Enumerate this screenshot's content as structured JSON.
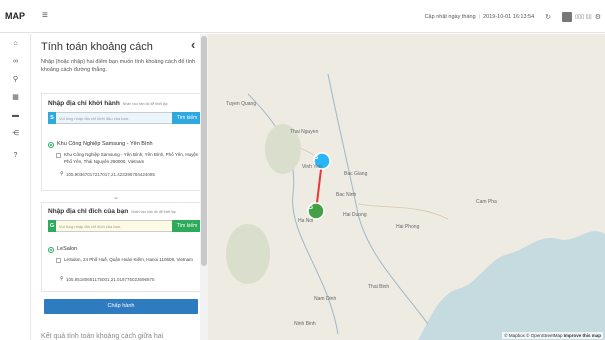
{
  "topbar": {
    "logo": "MAP",
    "menu_icon": "hamburger-icon",
    "update_label": "Cập nhật ngày tháng",
    "update_time": "2019-10-01 16:13:54",
    "user_name": "▯▯▯ ▯▯"
  },
  "icon_rail": [
    {
      "name": "home-icon",
      "glyph": "⌂"
    },
    {
      "name": "binoculars-icon",
      "glyph": "∞"
    },
    {
      "name": "search-icon",
      "glyph": "⚲"
    },
    {
      "name": "calculator-icon",
      "glyph": "▦"
    },
    {
      "name": "truck-icon",
      "glyph": "▬"
    },
    {
      "name": "share-icon",
      "glyph": "⋲"
    },
    {
      "name": "help-icon",
      "glyph": "?"
    }
  ],
  "panel": {
    "title": "Tính toán khoảng cách",
    "description": "Nhập (hoặc nhập) hai điểm bạn muốn tính khoảng cách để tính khoảng cách đường thẳng.",
    "start": {
      "heading": "Nhập địa chỉ khởi hành",
      "hint": "Nhấn vào bản đồ để thiết lập",
      "tag": "S",
      "placeholder": "Vui lòng nhập địa chỉ khởi đầu của bạn.",
      "button": "Tìm kiếm",
      "result_name": "Khu Công Nghiệp Samsung - Yên Bình",
      "result_address": "Khu Công Nghiệp Samsung - Yên Bình, Yên Bình, Phổ Yên, Huyện Phổ Yên, Thái Nguyên 250000, Vietnam",
      "result_coords": "105.90367017217017,21.423395784424095"
    },
    "dest": {
      "heading": "Nhập địa chỉ đích của bạn",
      "hint": "Nhấn vào bản đồ để thiết lập",
      "tag": "G",
      "placeholder": "Vui lòng nhập địa chỉ đích của bạn.",
      "button": "Tìm kiếm",
      "result_name": "LeSalon",
      "result_address": "LeSalon, 24 Phố Huế, Quận Hoàn Kiếm, Hanoi 110509, Vietnam",
      "result_coords": "105.85180681175001,21.018775023696875"
    },
    "execute_button": "Chấp hành",
    "result_heading": "Kết quả tính toán khoảng cách giữa hai"
  },
  "map": {
    "labels": [
      "Tuyen Quang",
      "Thai Nguyen",
      "Vinh Yen",
      "Bac Giang",
      "Ha Noi",
      "Hai Duong",
      "Hai Phong",
      "Cam Pha",
      "Nam Dinh",
      "Thai Binh",
      "Ninh Binh",
      "Bac Ninh"
    ],
    "start_marker": "S",
    "end_marker": "G",
    "attribution": "© Mapbox © OpenStreetMap",
    "attribution_link": "Improve this map",
    "colors": {
      "route": "#e53935",
      "start_marker": "#29b6f6",
      "end_marker": "#43a047",
      "green_button": "#2eaa5c",
      "blue_button": "#2fa8e0",
      "execute": "#2f7bbf"
    }
  }
}
